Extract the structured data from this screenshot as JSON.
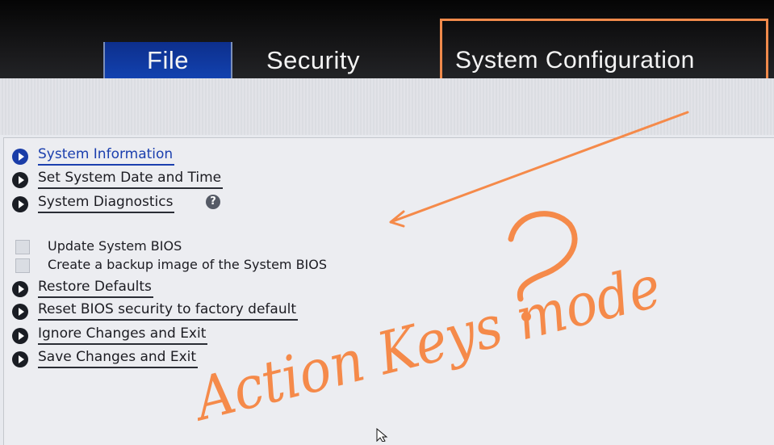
{
  "tabs": {
    "file": "File",
    "security": "Security",
    "system_configuration": "System Configuration"
  },
  "menu": {
    "system_information": "System Information",
    "set_date_time": "Set System Date and Time",
    "system_diagnostics": "System Diagnostics",
    "help_glyph": "?",
    "update_bios": "Update System BIOS",
    "backup_bios": "Create a backup image of the System BIOS",
    "restore_defaults": "Restore Defaults",
    "reset_bios_security": "Reset BIOS security to factory default",
    "ignore_changes": "Ignore Changes and Exit",
    "save_changes": "Save Changes and Exit"
  },
  "annotation": {
    "question_mark": "?",
    "handwritten_note": "Action Keys mode",
    "color": "#f58a4a"
  },
  "colors": {
    "tab_active": "#1242b0",
    "selected_text": "#1b3fae"
  },
  "icons": {
    "menu_bullet": "play-circle-icon",
    "help": "question-circle-icon",
    "pointer": "mouse-cursor-icon",
    "arrow": "annotation-arrow"
  }
}
